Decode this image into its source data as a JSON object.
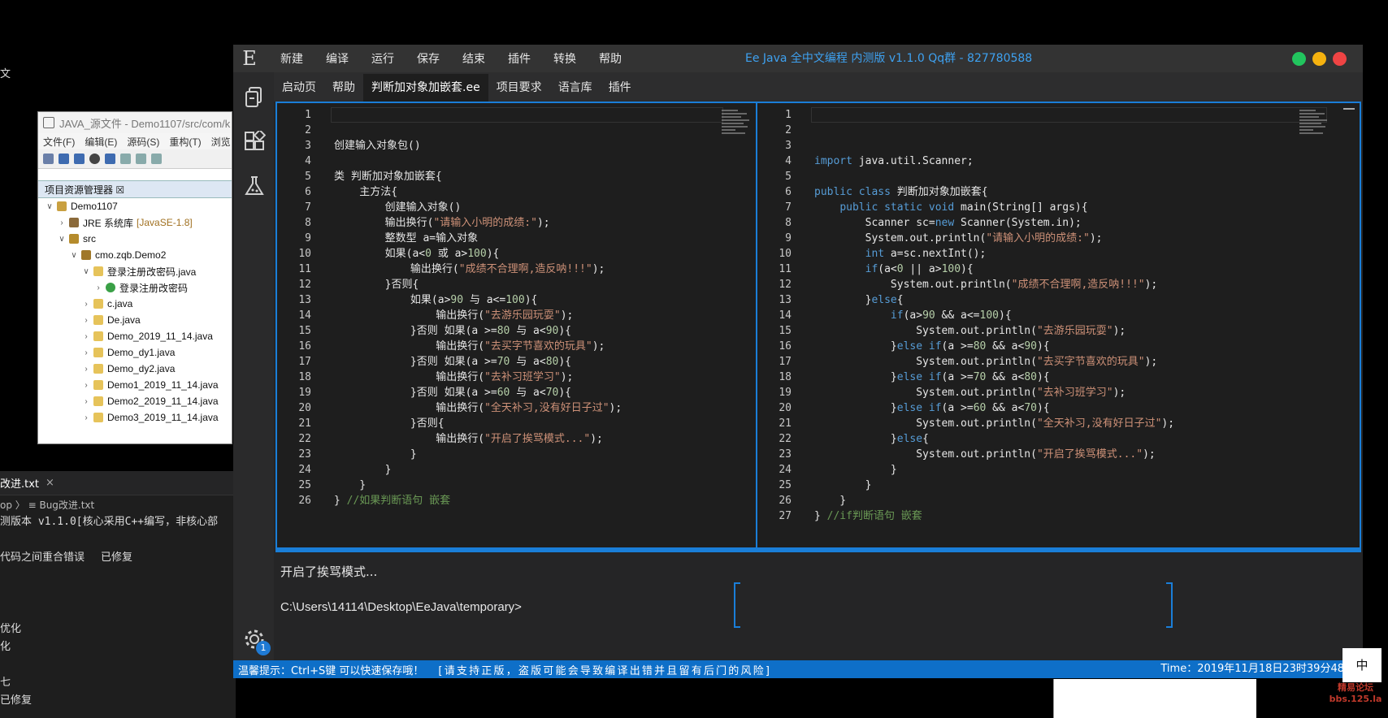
{
  "background": {
    "left_fragment": "文",
    "eclipse": {
      "title": "JAVA_源文件 - Demo1107/src/com/k",
      "menu": [
        "文件(F)",
        "编辑(E)",
        "源码(S)",
        "重构(T)",
        "浏览"
      ],
      "panel_title": "项目资源管理器 ☒",
      "tree": [
        {
          "indent": 0,
          "arrow": "∨",
          "icon": "project",
          "label": "Demo1107",
          "suffix": ""
        },
        {
          "indent": 1,
          "arrow": "›",
          "icon": "lib",
          "label": "JRE 系统库",
          "suffix": "[JavaSE-1.8]"
        },
        {
          "indent": 1,
          "arrow": "∨",
          "icon": "src",
          "label": "src",
          "suffix": ""
        },
        {
          "indent": 2,
          "arrow": "∨",
          "icon": "pkg",
          "label": "cmo.zqb.Demo2",
          "suffix": ""
        },
        {
          "indent": 3,
          "arrow": "∨",
          "icon": "java",
          "label": "登录注册改密码.java",
          "suffix": ""
        },
        {
          "indent": 4,
          "arrow": "›",
          "icon": "cls",
          "label": "登录注册改密码",
          "suffix": ""
        },
        {
          "indent": 3,
          "arrow": "›",
          "icon": "java",
          "label": "c.java",
          "suffix": ""
        },
        {
          "indent": 3,
          "arrow": "›",
          "icon": "java",
          "label": "De.java",
          "suffix": ""
        },
        {
          "indent": 3,
          "arrow": "›",
          "icon": "java",
          "label": "Demo_2019_11_14.java",
          "suffix": ""
        },
        {
          "indent": 3,
          "arrow": "›",
          "icon": "java",
          "label": "Demo_dy1.java",
          "suffix": ""
        },
        {
          "indent": 3,
          "arrow": "›",
          "icon": "java",
          "label": "Demo_dy2.java",
          "suffix": ""
        },
        {
          "indent": 3,
          "arrow": "›",
          "icon": "java",
          "label": "Demo1_2019_11_14.java",
          "suffix": ""
        },
        {
          "indent": 3,
          "arrow": "›",
          "icon": "java",
          "label": "Demo2_2019_11_14.java",
          "suffix": ""
        },
        {
          "indent": 3,
          "arrow": "›",
          "icon": "java",
          "label": "Demo3_2019_11_14.java",
          "suffix": ""
        }
      ]
    },
    "notes": {
      "tab": "改进.txt",
      "tab_close": "×",
      "crumb": "op 〉 ≡ Bug改进.txt",
      "lines": [
        {
          "text": "测版本 v1.1.0[核心采用C++编写，非核心部",
          "extra": ""
        },
        {
          "text": "",
          "extra": ""
        },
        {
          "text": "代码之间重合错误",
          "extra": "已修复"
        },
        {
          "text": "",
          "extra": ""
        },
        {
          "text": "",
          "extra": ""
        },
        {
          "text": "",
          "extra": ""
        },
        {
          "text": "优化",
          "extra": ""
        },
        {
          "text": "化",
          "extra": ""
        },
        {
          "text": "",
          "extra": ""
        },
        {
          "text": "七",
          "extra": ""
        },
        {
          "text": "已修复",
          "extra": ""
        }
      ]
    }
  },
  "app": {
    "logo": "E",
    "menu": [
      "新建",
      "编译",
      "运行",
      "保存",
      "结束",
      "插件",
      "转换",
      "帮助"
    ],
    "title": "Ee Java 全中文编程 内测版 v1.1.0   Qq群 - 827780588",
    "window_button_colors": [
      "#22c55e",
      "#f5b20f",
      "#ef4444"
    ],
    "tabs": [
      "启动页",
      "帮助",
      "判断加对象加嵌套.ee",
      "项目要求",
      "语言库",
      "插件"
    ],
    "active_tab": 2,
    "console": {
      "output": "开启了挨骂模式...",
      "prompt": "C:\\Users\\14114\\Desktop\\EeJava\\temporary>"
    },
    "status": {
      "tip": "温馨提示：Ctrl+S键 可以快速保存哦！",
      "warning": "[请支持正版，盗版可能会导致编译出错并且留有后门的风险]",
      "time": "Time：2019年11月18日23时39分48秒"
    },
    "gear_badge": "1"
  },
  "left_code": [
    [],
    [],
    [
      [
        "t",
        "创建输入对象包()"
      ]
    ],
    [],
    [
      [
        "t",
        "类 判断加对象加嵌套{"
      ]
    ],
    [
      [
        "t",
        "    主方法{"
      ]
    ],
    [
      [
        "t",
        "        创建输入对象()"
      ]
    ],
    [
      [
        "t",
        "        输出换行("
      ],
      [
        "s",
        "\"请输入小明的成绩:\""
      ],
      [
        "t",
        ");"
      ]
    ],
    [
      [
        "t",
        "        整数型 a=输入对象"
      ]
    ],
    [
      [
        "t",
        "        如果(a<"
      ],
      [
        "n",
        "0"
      ],
      [
        "t",
        " 或 a>"
      ],
      [
        "n",
        "100"
      ],
      [
        "t",
        "){"
      ]
    ],
    [
      [
        "t",
        "            输出换行("
      ],
      [
        "s",
        "\"成绩不合理啊,造反呐!!!\""
      ],
      [
        "t",
        ");"
      ]
    ],
    [
      [
        "t",
        "        }否则{"
      ]
    ],
    [
      [
        "t",
        "            如果(a>"
      ],
      [
        "n",
        "90"
      ],
      [
        "t",
        " 与 a<="
      ],
      [
        "n",
        "100"
      ],
      [
        "t",
        "){"
      ]
    ],
    [
      [
        "t",
        "                输出换行("
      ],
      [
        "s",
        "\"去游乐园玩耍\""
      ],
      [
        "t",
        ");"
      ]
    ],
    [
      [
        "t",
        "            }否则 如果(a >="
      ],
      [
        "n",
        "80"
      ],
      [
        "t",
        " 与 a<"
      ],
      [
        "n",
        "90"
      ],
      [
        "t",
        "){"
      ]
    ],
    [
      [
        "t",
        "                输出换行("
      ],
      [
        "s",
        "\"去买字节喜欢的玩具\""
      ],
      [
        "t",
        ");"
      ]
    ],
    [
      [
        "t",
        "            }否则 如果(a >="
      ],
      [
        "n",
        "70"
      ],
      [
        "t",
        " 与 a<"
      ],
      [
        "n",
        "80"
      ],
      [
        "t",
        "){"
      ]
    ],
    [
      [
        "t",
        "                输出换行("
      ],
      [
        "s",
        "\"去补习班学习\""
      ],
      [
        "t",
        ");"
      ]
    ],
    [
      [
        "t",
        "            }否则 如果(a >="
      ],
      [
        "n",
        "60"
      ],
      [
        "t",
        " 与 a<"
      ],
      [
        "n",
        "70"
      ],
      [
        "t",
        "){"
      ]
    ],
    [
      [
        "t",
        "                输出换行("
      ],
      [
        "s",
        "\"全天补习,没有好日子过\""
      ],
      [
        "t",
        ");"
      ]
    ],
    [
      [
        "t",
        "            }否则{"
      ]
    ],
    [
      [
        "t",
        "                输出换行("
      ],
      [
        "s",
        "\"开启了挨骂模式...\""
      ],
      [
        "t",
        ");"
      ]
    ],
    [
      [
        "t",
        "            }"
      ]
    ],
    [
      [
        "t",
        "        }"
      ]
    ],
    [
      [
        "t",
        "    }"
      ]
    ],
    [
      [
        "t",
        "} "
      ],
      [
        "c",
        "//如果判断语句 嵌套"
      ]
    ]
  ],
  "right_code": [
    [],
    [],
    [],
    [
      [
        "k",
        "import"
      ],
      [
        "t",
        " java.util.Scanner;"
      ]
    ],
    [],
    [
      [
        "k",
        "public class"
      ],
      [
        "t",
        " 判断加对象加嵌套{"
      ]
    ],
    [
      [
        "t",
        "    "
      ],
      [
        "k",
        "public static void"
      ],
      [
        "t",
        " main(String[] args){"
      ]
    ],
    [
      [
        "t",
        "        Scanner sc="
      ],
      [
        "k",
        "new"
      ],
      [
        "t",
        " Scanner(System.in);"
      ]
    ],
    [
      [
        "t",
        "        System.out.println("
      ],
      [
        "s",
        "\"请输入小明的成绩:\""
      ],
      [
        "t",
        ");"
      ]
    ],
    [
      [
        "t",
        "        "
      ],
      [
        "k",
        "int"
      ],
      [
        "t",
        " a=sc.nextInt();"
      ]
    ],
    [
      [
        "t",
        "        "
      ],
      [
        "k",
        "if"
      ],
      [
        "t",
        "(a<"
      ],
      [
        "n",
        "0"
      ],
      [
        "t",
        " || a>"
      ],
      [
        "n",
        "100"
      ],
      [
        "t",
        "){"
      ]
    ],
    [
      [
        "t",
        "            System.out.println("
      ],
      [
        "s",
        "\"成绩不合理啊,造反呐!!!\""
      ],
      [
        "t",
        ");"
      ]
    ],
    [
      [
        "t",
        "        }"
      ],
      [
        "k",
        "else"
      ],
      [
        "t",
        "{"
      ]
    ],
    [
      [
        "t",
        "            "
      ],
      [
        "k",
        "if"
      ],
      [
        "t",
        "(a>"
      ],
      [
        "n",
        "90"
      ],
      [
        "t",
        " && a<="
      ],
      [
        "n",
        "100"
      ],
      [
        "t",
        "){"
      ]
    ],
    [
      [
        "t",
        "                System.out.println("
      ],
      [
        "s",
        "\"去游乐园玩耍\""
      ],
      [
        "t",
        ");"
      ]
    ],
    [
      [
        "t",
        "            }"
      ],
      [
        "k",
        "else if"
      ],
      [
        "t",
        "(a >="
      ],
      [
        "n",
        "80"
      ],
      [
        "t",
        " && a<"
      ],
      [
        "n",
        "90"
      ],
      [
        "t",
        "){"
      ]
    ],
    [
      [
        "t",
        "                System.out.println("
      ],
      [
        "s",
        "\"去买字节喜欢的玩具\""
      ],
      [
        "t",
        ");"
      ]
    ],
    [
      [
        "t",
        "            }"
      ],
      [
        "k",
        "else if"
      ],
      [
        "t",
        "(a >="
      ],
      [
        "n",
        "70"
      ],
      [
        "t",
        " && a<"
      ],
      [
        "n",
        "80"
      ],
      [
        "t",
        "){"
      ]
    ],
    [
      [
        "t",
        "                System.out.println("
      ],
      [
        "s",
        "\"去补习班学习\""
      ],
      [
        "t",
        ");"
      ]
    ],
    [
      [
        "t",
        "            }"
      ],
      [
        "k",
        "else if"
      ],
      [
        "t",
        "(a >="
      ],
      [
        "n",
        "60"
      ],
      [
        "t",
        " && a<"
      ],
      [
        "n",
        "70"
      ],
      [
        "t",
        "){"
      ]
    ],
    [
      [
        "t",
        "                System.out.println("
      ],
      [
        "s",
        "\"全天补习,没有好日子过\""
      ],
      [
        "t",
        ");"
      ]
    ],
    [
      [
        "t",
        "            }"
      ],
      [
        "k",
        "else"
      ],
      [
        "t",
        "{"
      ]
    ],
    [
      [
        "t",
        "                System.out.println("
      ],
      [
        "s",
        "\"开启了挨骂模式...\""
      ],
      [
        "t",
        ");"
      ]
    ],
    [
      [
        "t",
        "            }"
      ]
    ],
    [
      [
        "t",
        "        }"
      ]
    ],
    [
      [
        "t",
        "    }"
      ]
    ],
    [
      [
        "t",
        "} "
      ],
      [
        "c",
        "//if判断语句 嵌套"
      ]
    ]
  ],
  "ime": "中",
  "watermark": "精易论坛 bbs.125.la"
}
